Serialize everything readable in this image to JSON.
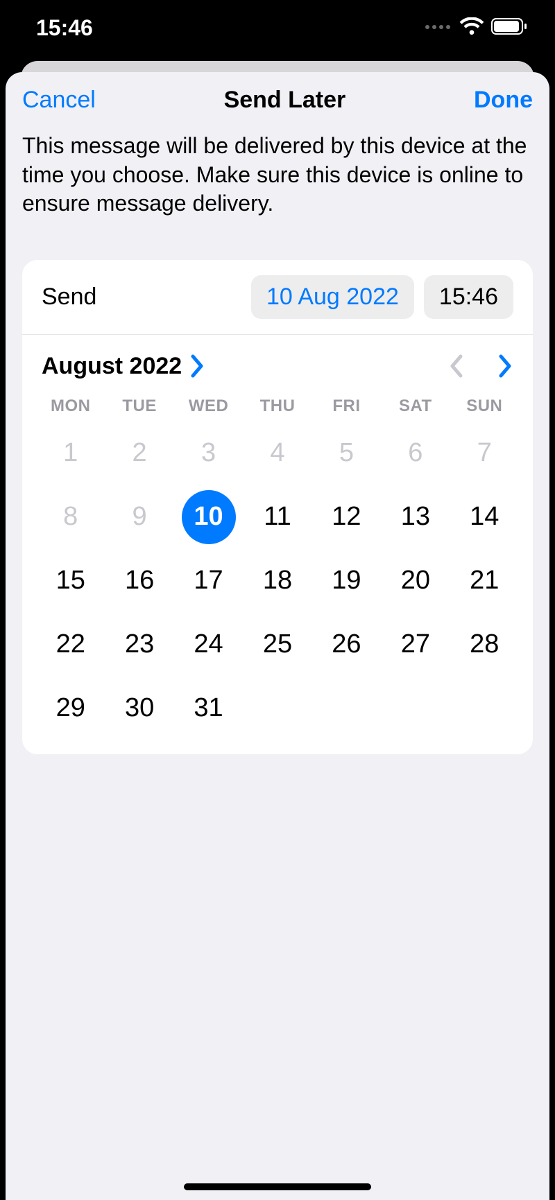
{
  "status": {
    "time": "15:46"
  },
  "nav": {
    "cancel": "Cancel",
    "title": "Send Later",
    "done": "Done"
  },
  "description": "This message will be delivered by this device at the time you choose. Make sure this device is online to ensure message delivery.",
  "send": {
    "label": "Send",
    "date": "10 Aug 2022",
    "time": "15:46"
  },
  "calendar": {
    "month_label": "August 2022",
    "weekdays": [
      "MON",
      "TUE",
      "WED",
      "THU",
      "FRI",
      "SAT",
      "SUN"
    ],
    "selected_day": 10,
    "weeks": [
      [
        {
          "n": 1,
          "past": true
        },
        {
          "n": 2,
          "past": true
        },
        {
          "n": 3,
          "past": true
        },
        {
          "n": 4,
          "past": true
        },
        {
          "n": 5,
          "past": true
        },
        {
          "n": 6,
          "past": true
        },
        {
          "n": 7,
          "past": true
        }
      ],
      [
        {
          "n": 8,
          "past": true
        },
        {
          "n": 9,
          "past": true
        },
        {
          "n": 10,
          "selected": true
        },
        {
          "n": 11
        },
        {
          "n": 12
        },
        {
          "n": 13
        },
        {
          "n": 14
        }
      ],
      [
        {
          "n": 15
        },
        {
          "n": 16
        },
        {
          "n": 17
        },
        {
          "n": 18
        },
        {
          "n": 19
        },
        {
          "n": 20
        },
        {
          "n": 21
        }
      ],
      [
        {
          "n": 22
        },
        {
          "n": 23
        },
        {
          "n": 24
        },
        {
          "n": 25
        },
        {
          "n": 26
        },
        {
          "n": 27
        },
        {
          "n": 28
        }
      ],
      [
        {
          "n": 29
        },
        {
          "n": 30
        },
        {
          "n": 31
        },
        null,
        null,
        null,
        null
      ]
    ]
  },
  "colors": {
    "accent": "#007aff"
  }
}
